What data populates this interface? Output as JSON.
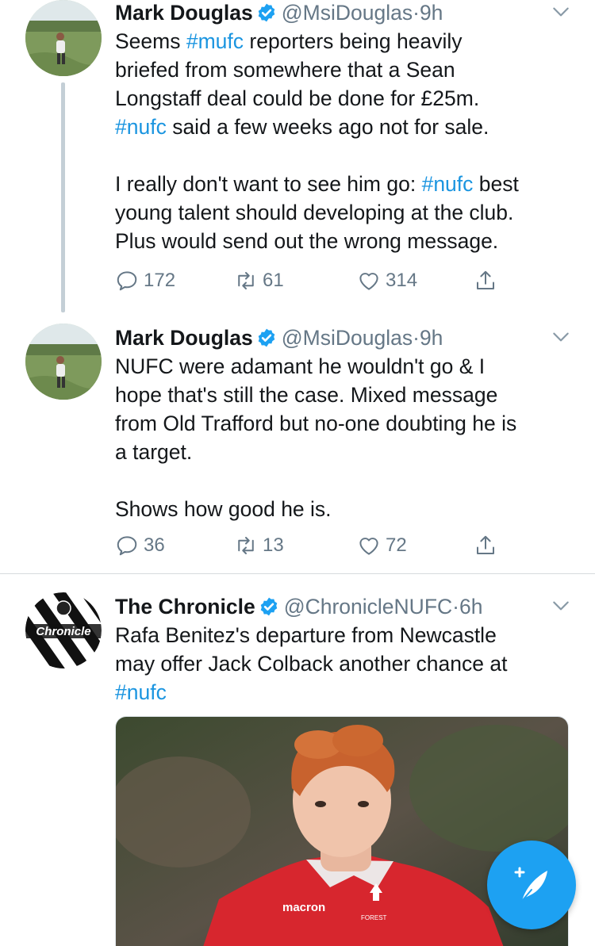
{
  "colors": {
    "link": "#1b95e0",
    "muted": "#657786",
    "fab": "#1da1f2",
    "verified": "#1da1f2"
  },
  "tweets": [
    {
      "name": "Mark Douglas",
      "verified_icon": "verified-badge-icon",
      "handle": "@MsiDouglas",
      "sep": "·",
      "time": "9h",
      "lines": [
        {
          "segments": [
            {
              "t": "Seems ",
              "h": false
            },
            {
              "t": "#mufc",
              "h": true
            },
            {
              "t": " reporters being heavily",
              "h": false
            }
          ]
        },
        {
          "segments": [
            {
              "t": "briefed from somewhere that a Sean",
              "h": false
            }
          ]
        },
        {
          "segments": [
            {
              "t": "Longstaff deal could be done for £25m.",
              "h": false
            }
          ]
        },
        {
          "segments": [
            {
              "t": "#nufc",
              "h": true
            },
            {
              "t": " said a few weeks ago not for sale.",
              "h": false
            }
          ]
        },
        {
          "segments": []
        },
        {
          "segments": [
            {
              "t": "I really don't want to see him go: ",
              "h": false
            },
            {
              "t": "#nufc",
              "h": true
            },
            {
              "t": " best",
              "h": false
            }
          ]
        },
        {
          "segments": [
            {
              "t": "young talent should developing at the club.",
              "h": false
            }
          ]
        },
        {
          "segments": [
            {
              "t": "Plus would send out the wrong message.",
              "h": false
            }
          ]
        }
      ],
      "replies": "172",
      "retweets": "61",
      "likes": "314"
    },
    {
      "name": "Mark Douglas",
      "verified_icon": "verified-badge-icon",
      "handle": "@MsiDouglas",
      "sep": "·",
      "time": "9h",
      "lines": [
        {
          "segments": [
            {
              "t": "NUFC were adamant he wouldn't go & I",
              "h": false
            }
          ]
        },
        {
          "segments": [
            {
              "t": "hope that's still the case. Mixed message",
              "h": false
            }
          ]
        },
        {
          "segments": [
            {
              "t": "from Old Trafford but no-one doubting he is",
              "h": false
            }
          ]
        },
        {
          "segments": [
            {
              "t": "a target.",
              "h": false
            }
          ]
        },
        {
          "segments": []
        },
        {
          "segments": [
            {
              "t": "Shows how good he is.",
              "h": false
            }
          ]
        }
      ],
      "replies": "36",
      "retweets": "13",
      "likes": "72"
    },
    {
      "name": "The Chronicle",
      "verified_icon": "verified-badge-icon",
      "handle": "@ChronicleNUFC",
      "sep": "·",
      "time": "6h",
      "lines": [
        {
          "segments": [
            {
              "t": "Rafa Benitez's departure from Newcastle",
              "h": false
            }
          ]
        },
        {
          "segments": [
            {
              "t": "may offer Jack Colback another chance at",
              "h": false
            }
          ]
        },
        {
          "segments": [
            {
              "t": "#nufc",
              "h": true
            }
          ]
        }
      ],
      "avatar_logo_text": "Chronicle",
      "media_sponsor": "macron",
      "media_crest": "FOREST"
    }
  ],
  "fab": {
    "icon": "compose-tweet-icon"
  }
}
